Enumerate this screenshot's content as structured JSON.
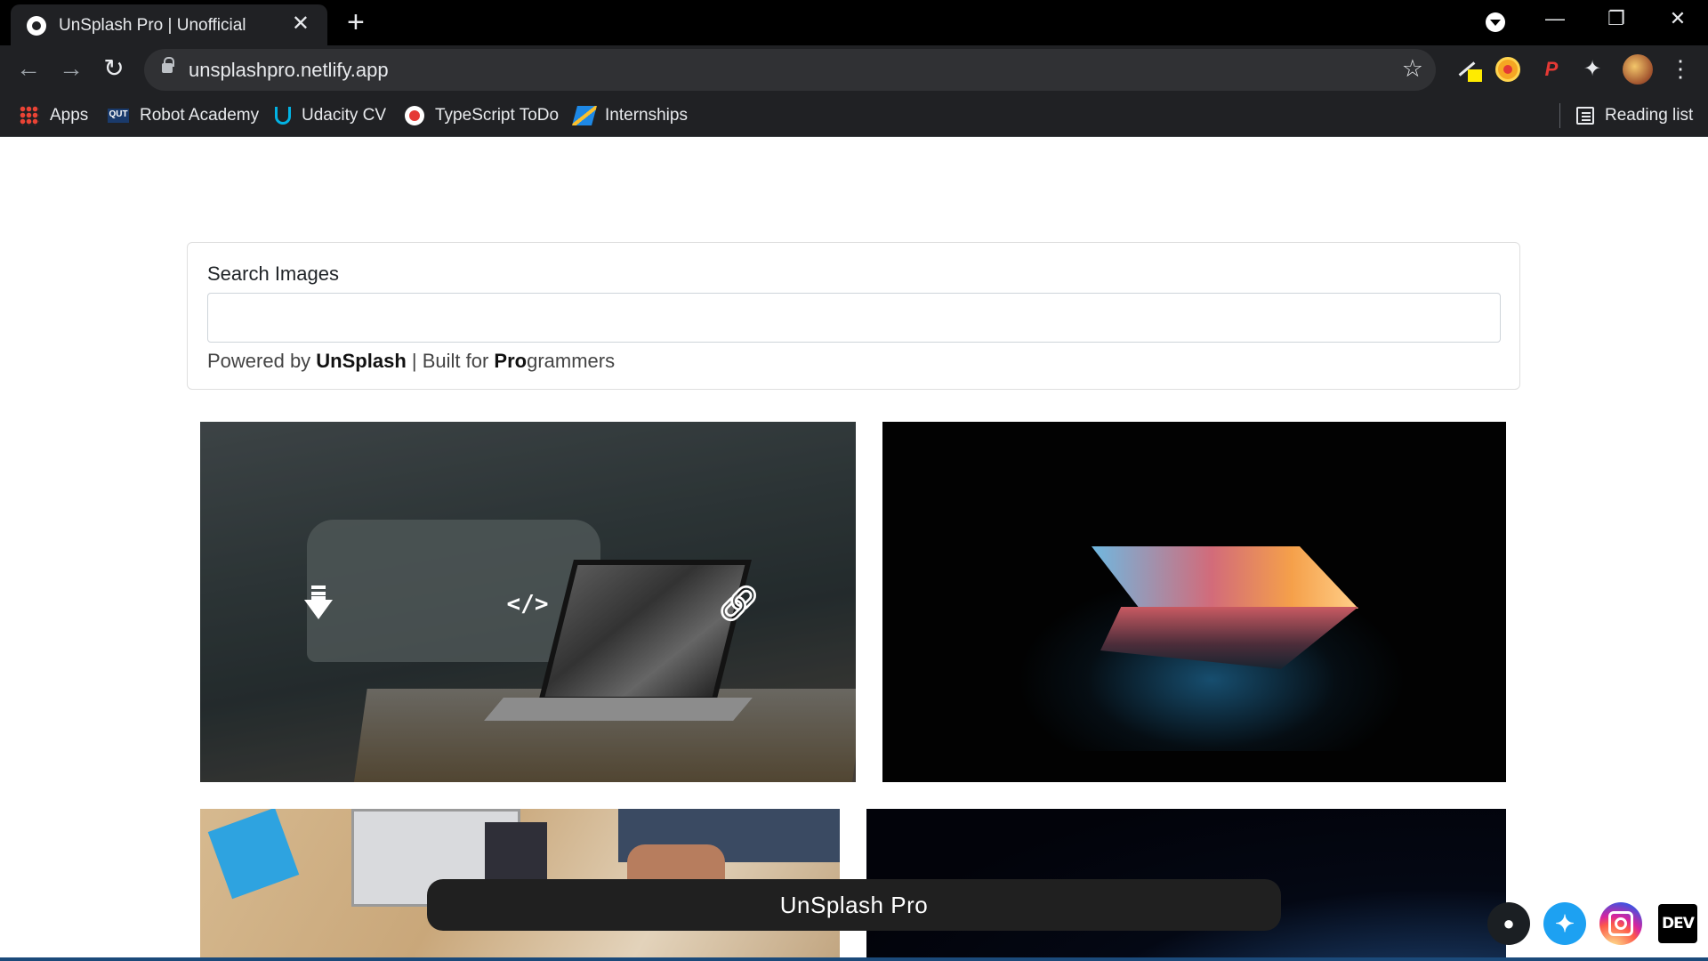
{
  "browser": {
    "tab_title": "UnSplash Pro | Unofficial",
    "new_tab_label": "+",
    "url": "unsplashpro.netlify.app",
    "bookmarks": [
      {
        "label": "Apps",
        "icon": "apps-grid-icon"
      },
      {
        "label": "Robot Academy",
        "icon": "qut-icon"
      },
      {
        "label": "Udacity CV",
        "icon": "udacity-icon"
      },
      {
        "label": "TypeScript ToDo",
        "icon": "typescript-todo-icon"
      },
      {
        "label": "Internships",
        "icon": "internships-icon"
      }
    ],
    "reading_list": "Reading list"
  },
  "search": {
    "label": "Search Images",
    "value": "",
    "powered_prefix": "Powered by ",
    "powered_brand": "UnSplash",
    "powered_sep": " | Built for ",
    "powered_pro": "Pro",
    "powered_suffix": "grammers"
  },
  "photo_actions": {
    "download_icon": "download-icon",
    "code_label": "</>",
    "link_icon": "link-icon"
  },
  "footer": {
    "title": "UnSplash Pro",
    "social": [
      "github-icon",
      "twitter-icon",
      "instagram-icon",
      "dev-icon"
    ],
    "dev_label": "DEV"
  },
  "colors": {
    "chrome_dark": "#202124",
    "footer_bar": "#202020",
    "twitter": "#1da1f2"
  }
}
